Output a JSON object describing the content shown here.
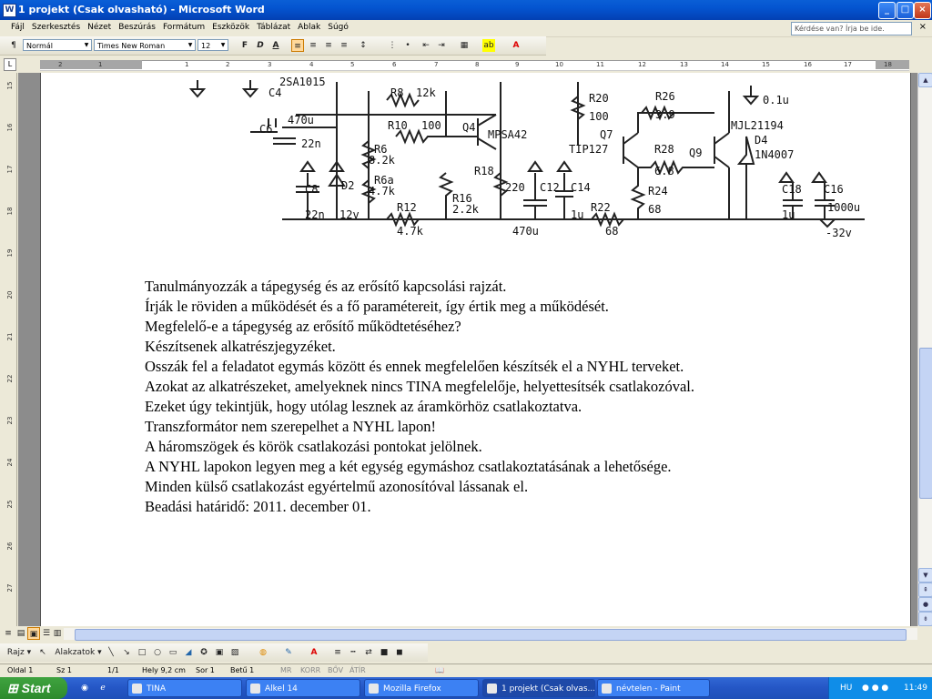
{
  "window": {
    "title": "1 projekt (Csak olvasható) - Microsoft Word",
    "app_icon": "W",
    "buttons": {
      "minimize": "_",
      "maximize": "□",
      "close": "×"
    }
  },
  "menu": {
    "items": [
      "Fájl",
      "Szerkesztés",
      "Nézet",
      "Beszúrás",
      "Formátum",
      "Eszközök",
      "Táblázat",
      "Ablak",
      "Súgó"
    ],
    "help_placeholder": "Kérdése van? Írja be ide.",
    "close_doc": "×"
  },
  "format_toolbar": {
    "style": "Normál",
    "font": "Times New Roman",
    "size": "12",
    "bold": "F",
    "italic": "D",
    "underline": "A",
    "align_left_active": true
  },
  "ruler": {
    "numbers": [
      "2",
      "1",
      "1",
      "2",
      "3",
      "4",
      "5",
      "6",
      "7",
      "8",
      "9",
      "10",
      "11",
      "12",
      "13",
      "14",
      "15",
      "16",
      "17",
      "18"
    ],
    "vertical_numbers": [
      "15",
      "16",
      "17",
      "18",
      "19",
      "20",
      "21",
      "22",
      "23",
      "24",
      "25",
      "26",
      "27",
      "28"
    ]
  },
  "schematic": {
    "labels": [
      "2SA1015",
      "C4",
      "470u",
      "C6",
      "22n",
      "R8",
      "12k",
      "R10",
      "100",
      "Q4",
      "MPSA42",
      "R6",
      "8.2k",
      "R6a",
      "4.7k",
      "C8",
      "22n",
      "D2",
      "12v",
      "R12",
      "4.7k",
      "R16",
      "2.2k",
      "R18",
      "220",
      "C12",
      "470u",
      "C14",
      "1u",
      "R22",
      "68",
      "R20",
      "100",
      "Q7",
      "TIP127",
      "R26",
      "3.9",
      "R28",
      "6.8",
      "R24",
      "68",
      "Q9",
      "MJL21194",
      "D4",
      "1N4007",
      "0.1u",
      "C18",
      "1u",
      "C16",
      "1000u",
      "-32v"
    ]
  },
  "document": {
    "lines": [
      "Tanulmányozzák a tápegység és az erősítő kapcsolási rajzát.",
      "Írják le röviden a működését és a fő paramétereit, így értik meg a működését.",
      "Megfelelő-e a tápegység az erősítő működtetéséhez?",
      "Készítsenek alkatrészjegyzéket.",
      "Osszák fel a feladatot egymás között és ennek megfelelően készítsék el a NYHL terveket.",
      "Azokat az alkatrészeket, amelyeknek nincs TINA megfelelője, helyettesítsék csatlakozóval.",
      "Ezeket úgy tekintjük, hogy utólag lesznek az áramkörhöz csatlakoztatva.",
      "Transzformátor nem szerepelhet a NYHL lapon!",
      "A háromszögek és körök csatlakozási pontokat jelölnek.",
      "A NYHL lapokon legyen meg a két egység egymáshoz csatlakoztatásának a lehetősége.",
      "Minden külső csatlakozást egyértelmű azonosítóval lássanak el.",
      "Beadási határidő: 2011. december 01."
    ]
  },
  "draw_toolbar": {
    "draw": "Rajz",
    "autoshapes": "Alakzatok"
  },
  "status": {
    "page": "Oldal 1",
    "section": "Sz 1",
    "pages": "1/1",
    "position": "Hely 9,2 cm",
    "line": "Sor 1",
    "column": "Betű 1",
    "modes": [
      "MR",
      "KORR",
      "BŐV",
      "ÁTÍR"
    ]
  },
  "taskbar": {
    "start": "Start",
    "tasks": [
      {
        "label": "TINA",
        "active": false
      },
      {
        "label": "Alkel 14",
        "active": false
      },
      {
        "label": "Mozilla Firefox",
        "active": false
      },
      {
        "label": "1 projekt (Csak olvas...",
        "active": true
      },
      {
        "label": "névtelen - Paint",
        "active": false
      }
    ],
    "lang": "HU",
    "time": "11:49"
  },
  "colors": {
    "title_bar": "#0454d0",
    "taskbar": "#2456c5",
    "start": "#3fa33f",
    "tray": "#0f8de8",
    "page": "#ffffff"
  }
}
